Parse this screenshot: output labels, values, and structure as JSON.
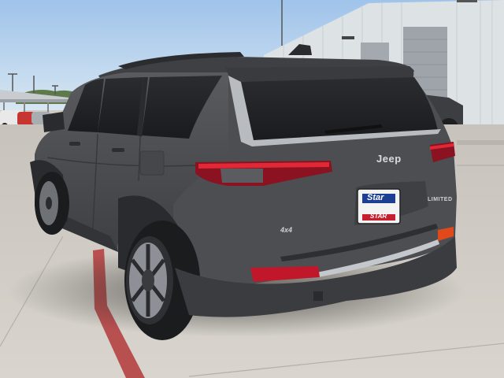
{
  "vehicle": {
    "brand_badge": "Jeep",
    "drive_badge": "4x4",
    "trim_badge": "LIMITED"
  },
  "dealer_plate": {
    "line1": "Star",
    "line2": "STAR"
  },
  "colors": {
    "body": "#4a4b4e",
    "sky": "#bcd6ee",
    "pavement": "#d4d0c8",
    "building": "#dfe3e6",
    "taillight": "#c0182a",
    "red_stripe": "#b8504f"
  }
}
